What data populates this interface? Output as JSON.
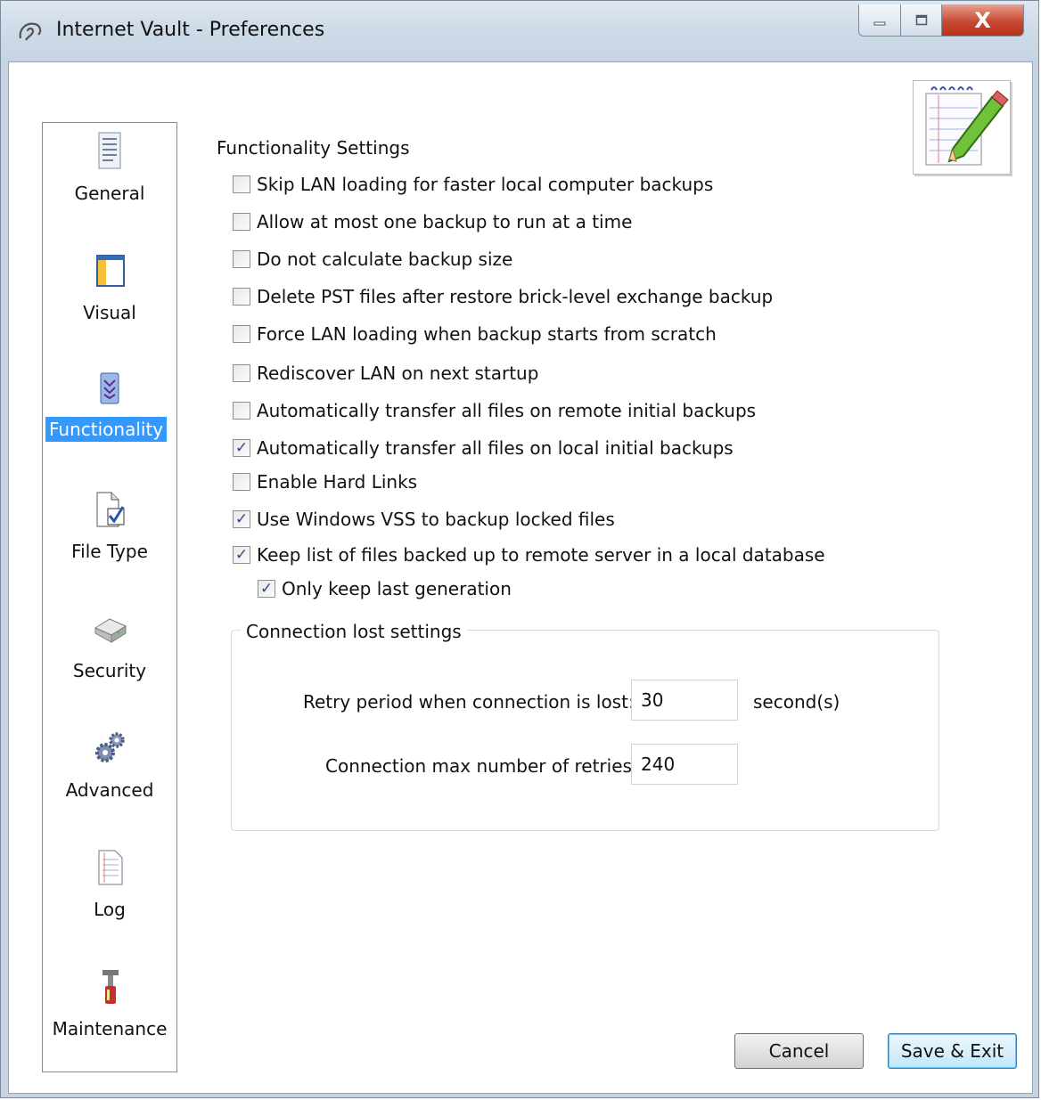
{
  "window": {
    "title": "Internet Vault - Preferences",
    "close_glyph": "X",
    "accent_color": "#3399ff"
  },
  "sidebar": {
    "items": [
      {
        "label": "General",
        "icon": "general-icon"
      },
      {
        "label": "Visual",
        "icon": "visual-icon"
      },
      {
        "label": "Functionality",
        "icon": "functionality-icon",
        "active": true
      },
      {
        "label": "File Type",
        "icon": "file-type-icon"
      },
      {
        "label": "Security",
        "icon": "security-icon"
      },
      {
        "label": "Advanced",
        "icon": "gears-icon"
      },
      {
        "label": "Log",
        "icon": "log-icon"
      },
      {
        "label": "Maintenance",
        "icon": "maintenance-icon"
      }
    ]
  },
  "main": {
    "section_title": "Functionality Settings",
    "options": [
      {
        "label": "Skip LAN loading for faster local computer backups",
        "checked": false
      },
      {
        "label": "Allow at most one backup to run at a time",
        "checked": false
      },
      {
        "label": "Do not calculate backup size",
        "checked": false
      },
      {
        "label": "Delete PST files after restore brick-level exchange backup",
        "checked": false
      },
      {
        "label": "Force LAN loading when backup starts from scratch",
        "checked": false
      },
      {
        "label": "Rediscover LAN on next startup",
        "checked": false
      },
      {
        "label": "Automatically transfer all files on remote initial backups",
        "checked": false
      },
      {
        "label": "Automatically transfer all files on local initial backups",
        "checked": true
      },
      {
        "label": "Enable Hard Links",
        "checked": false
      },
      {
        "label": "Use Windows VSS to backup locked files",
        "checked": true
      },
      {
        "label": "Keep list of files backed up to remote server in a local database",
        "checked": true
      },
      {
        "label": "Only keep last generation",
        "checked": true
      }
    ],
    "connection": {
      "group_title": "Connection lost settings",
      "retry_label": "Retry period when connection is lost:",
      "retry_value": "30",
      "retry_unit": "second(s)",
      "max_retries_label": "Connection max number of retries:",
      "max_retries_value": "240"
    }
  },
  "buttons": {
    "cancel_label": "Cancel",
    "save_label": "Save & Exit"
  }
}
